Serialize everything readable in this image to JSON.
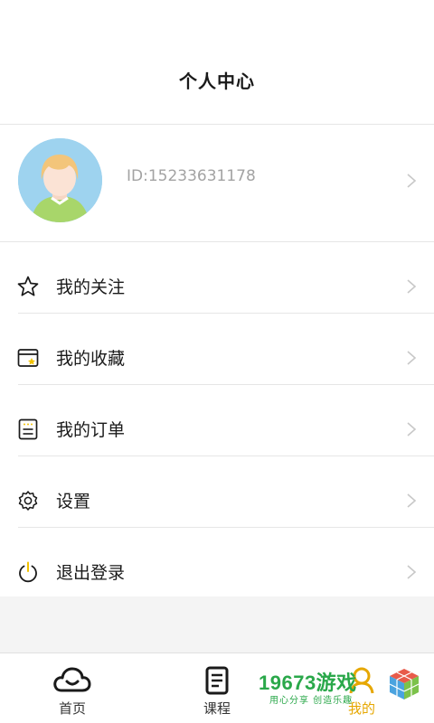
{
  "header": {
    "title": "个人中心"
  },
  "profile": {
    "user_id": "ID:15233631178",
    "avatar_icon": "user-avatar"
  },
  "menu": [
    {
      "label": "我的关注",
      "icon": "star-icon"
    },
    {
      "label": "我的收藏",
      "icon": "favorites-folder-icon"
    },
    {
      "label": "我的订单",
      "icon": "order-list-icon"
    },
    {
      "label": "设置",
      "icon": "gear-icon"
    },
    {
      "label": "退出登录",
      "icon": "power-icon"
    }
  ],
  "tabbar": {
    "tabs": [
      {
        "label": "首页",
        "icon": "home-cloud-icon"
      },
      {
        "label": "课程",
        "icon": "course-doc-icon"
      },
      {
        "label": "我的",
        "icon": "profile-icon",
        "active": true
      }
    ],
    "active_color": "#e6a700"
  },
  "watermark": {
    "main": "19673游戏",
    "sub": "用心分享 创造乐趣"
  },
  "colors": {
    "accent": "#e6a700",
    "text": "#1a1a1a",
    "muted": "#a3a3a3",
    "divider": "#e6e6e6"
  }
}
